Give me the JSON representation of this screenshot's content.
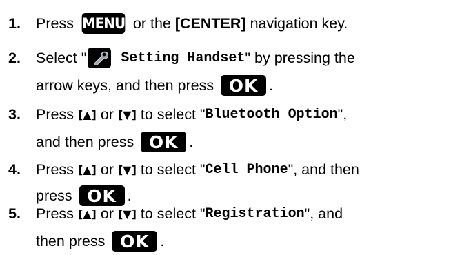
{
  "steps": [
    {
      "number": "1.",
      "text_before": "Press ",
      "key": "MENU",
      "text_mid": " or the ",
      "bold": "[CENTER]",
      "text_after": " navigation key."
    },
    {
      "number": "2.",
      "text_before": "Select \"",
      "icon": "wrench-icon",
      "mono": " Setting Handset",
      "text_after": "\" by pressing the",
      "line2_before": "arrow keys, and then press ",
      "key": "OK",
      "line2_after": "."
    },
    {
      "number": "3.",
      "text_before": "Press ",
      "up": "[▲]",
      "text_mid": " or ",
      "down": "[▼]",
      "text_sel": " to select \"",
      "mono": "Bluetooth Option",
      "text_after": "\",",
      "line2_before": "and then press ",
      "key": "OK",
      "line2_after": "."
    },
    {
      "number": "4.",
      "text_before": "Press ",
      "up": "[▲]",
      "text_mid": " or ",
      "down": "[▼]",
      "text_sel": " to select \"",
      "mono": "Cell Phone",
      "text_after": "\", and then",
      "line2_before": "press ",
      "key": "OK",
      "line2_after": "."
    },
    {
      "number": "5.",
      "text_before": "Press ",
      "up": "[▲]",
      "text_mid": " or ",
      "down": "[▼]",
      "text_sel": " to select \"",
      "mono": "Registration",
      "text_after": "\", and",
      "line2_before": "then press ",
      "key": "OK",
      "line2_after": "."
    }
  ],
  "colors": {
    "text": "#000000",
    "key_bg": "#000000",
    "key_text": "#ffffff",
    "tool_icon": "#9aa3a8"
  }
}
